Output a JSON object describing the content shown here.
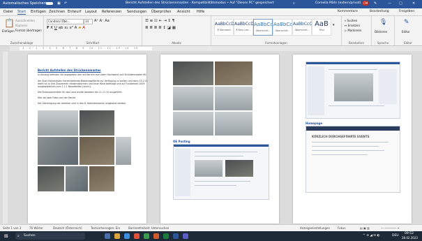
{
  "titlebar": {
    "autosave": "Automatisches Speichern",
    "doc_title": "Bericht Aufstellen des Strückennmasten - Kompatibilitätsmodus • Auf \"Dieses PC\" gespeichert",
    "search_icon": "search-icon",
    "user": "Cornelia Mähr (extern/privat)",
    "badge": "CM"
  },
  "menu": [
    "Datei",
    "Start",
    "Einfügen",
    "Zeichnen",
    "Entwurf",
    "Layout",
    "Referenzen",
    "Sendungen",
    "Überprüfen",
    "Ansicht",
    "Hilfe"
  ],
  "menu_right": {
    "comments": "Kommentare",
    "editing": "Bearbeitung",
    "share": "Freigeben"
  },
  "ribbon": {
    "clipboard": {
      "paste": "Einfügen",
      "cut": "Ausschneiden",
      "copy": "Kopieren",
      "format": "Format übertragen",
      "label": "Zwischenablage"
    },
    "font": {
      "name": "Candara (Übe...",
      "size": "14",
      "label": "Schriftart"
    },
    "paragraph": {
      "label": "Absatz"
    },
    "styles": {
      "items": [
        {
          "sample": "AaBbCcDd",
          "name": "¶ Standard"
        },
        {
          "sample": "AaBbCcDd",
          "name": "¶ Kein Lee..."
        },
        {
          "sample": "AaBbCc",
          "name": "Überschrif..."
        },
        {
          "sample": "AaBbCc",
          "name": "Überschrif..."
        },
        {
          "sample": "AaBbCcC",
          "name": "Überschrif..."
        },
        {
          "sample": "AaB",
          "name": "Titel"
        }
      ],
      "label": "Formatvorlagen"
    },
    "editing": {
      "search": "Suchen",
      "replace": "Ersetzen",
      "mark": "Markieren",
      "label": "Bearbeiten"
    },
    "voice": {
      "dictate": "Diktieren",
      "label": "Sprache"
    },
    "editor": {
      "name": "Editor",
      "label": "Editor"
    }
  },
  "ruler_text": "· 1 · 2 · 1 · 3 · 4 · 5 · 6 · 7 · 8 · 9 · 10 · 11 · 12 · 13 · 14 · 15",
  "page1": {
    "title": "Bericht Aufstellen des Strückennmastes",
    "lines": [
      "In Anhang befinden Sie angegeben den mit Bericht zum beim Hochwand und Strückenmasten 60.",
      "Am Start Hochmasten herzerstellende Bodenlagefläche zur Verfügung zu stellen und dann 10.2.11",
      "dreht ist zu Ihre Zusammen Hindernisformen und einer Wind befestigt und auf Fundament 2009",
      "ausgestattet bis zum 1.1.1 Bauarbeiten [durch].",
      "Die Einbauparameter für das Land wurde daneben am 11.11.10 ausgeführt.",
      "Hier als zwei Fotos von der Decke:",
      "Die Übertragung der Arbeiten sind in den 8. Kalenderwoche umgesetzt werden."
    ]
  },
  "page2": {
    "heading": "OE Posting"
  },
  "page3": {
    "heading": "Homepage",
    "headline": "KÜRZLICH DURCHGEFÜHRTE EVENTS"
  },
  "status": {
    "page": "Seite 1 von 3",
    "words": "76 Wörter",
    "lang": "Deutsch (Österreich)",
    "predict": "Textvorhersagen: Ein",
    "access": "Barrierefreiheit: Untersuchen",
    "focus": "Anzeigeeinstellungen",
    "focus2": "Fokus"
  },
  "taskbar": {
    "search": "Suchen",
    "time": "09:52",
    "date": "28.02.2023",
    "lang": "DEU"
  },
  "colors": {
    "accent": "#2b579a",
    "taskbar": "#1f2a38"
  }
}
